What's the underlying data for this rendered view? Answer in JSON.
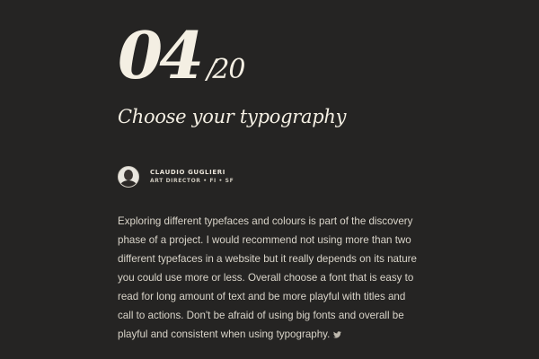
{
  "counter": {
    "current": "04",
    "separator": "/",
    "total": "20"
  },
  "headline": "Choose your typography",
  "author": {
    "name": "CLAUDIO GUGLIERI",
    "role": "ART DIRECTOR • FI • SF",
    "avatar_icon": "person-portrait-icon"
  },
  "body": "Exploring different typefaces and colours is part of the discovery phase of a project. I would recommend not using more than two different typefaces in a website but it really depends on its nature you could use more or less. Overall choose a font that is easy to read for long amount of text and be more playful with titles and call to actions.  Don't be afraid of using big fonts and overall be playful and consistent when using typography.",
  "share": {
    "icon": "twitter-icon"
  },
  "colors": {
    "background": "#252423",
    "text": "#f1ece1"
  }
}
